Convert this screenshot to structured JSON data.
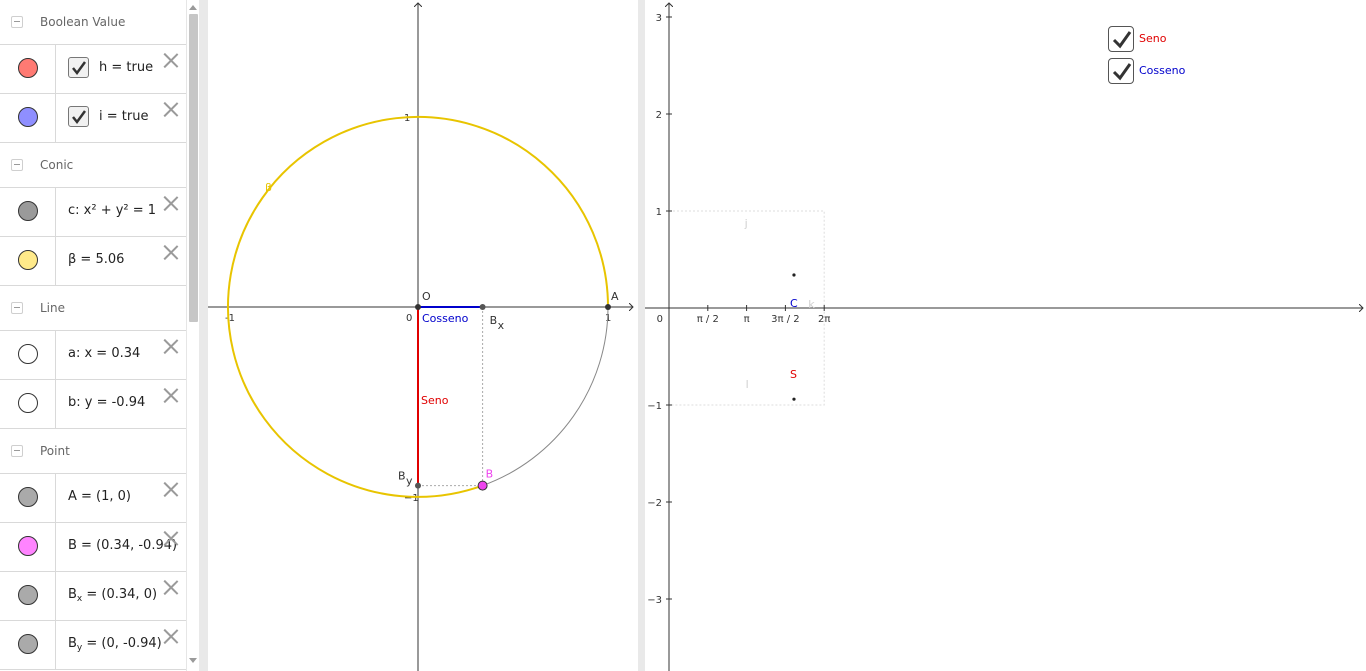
{
  "algebra": {
    "groups": [
      {
        "title": "Boolean Value",
        "items": [
          {
            "color": "#ff7a73",
            "checkbox": true,
            "text": "h = true"
          },
          {
            "color": "#8f8fff",
            "checkbox": true,
            "text": "i = true"
          }
        ]
      },
      {
        "title": "Conic",
        "items": [
          {
            "color": "#9a9a9a",
            "checkbox": false,
            "text": "c: x² + y² = 1"
          },
          {
            "color": "#ffea8a",
            "checkbox": false,
            "text": "β = 5.06"
          }
        ]
      },
      {
        "title": "Line",
        "items": [
          {
            "color": "#ffffff",
            "checkbox": false,
            "text": "a: x = 0.34"
          },
          {
            "color": "#ffffff",
            "checkbox": false,
            "text": "b: y = -0.94"
          }
        ]
      },
      {
        "title": "Point",
        "items": [
          {
            "color": "#aaaaaa",
            "checkbox": false,
            "text": "A = (1, 0)"
          },
          {
            "color": "#ff84ff",
            "checkbox": false,
            "text": "B = (0.34, -0.94)"
          },
          {
            "color": "#aaaaaa",
            "checkbox": false,
            "name_main": "B",
            "name_sub": "x",
            "rest": " = (0.34, 0)"
          },
          {
            "color": "#aaaaaa",
            "checkbox": false,
            "name_main": "B",
            "name_sub": "y",
            "rest": " = (0, -0.94)"
          }
        ]
      }
    ]
  },
  "view1": {
    "x_ticks": [
      {
        "value": -1,
        "label": "-1"
      },
      {
        "value": 0,
        "label": "0"
      },
      {
        "value": 1,
        "label": "1"
      }
    ],
    "y_ticks": [
      {
        "value": 1,
        "label": "1"
      },
      {
        "value": -1,
        "label": "−1"
      }
    ],
    "angle_label": "β",
    "points": {
      "O": {
        "label": "O",
        "x": 0,
        "y": 0
      },
      "A": {
        "label": "A",
        "x": 1,
        "y": 0
      },
      "B": {
        "label": "B",
        "x": 0.34,
        "y": -0.94
      },
      "Bx": {
        "label": "B",
        "sub": "x",
        "x": 0.34,
        "y": 0
      },
      "By": {
        "label": "B",
        "sub": "y",
        "x": 0,
        "y": -0.94
      }
    },
    "seno_label": "Seno",
    "cosseno_label": "Cosseno",
    "colors": {
      "circle": "#e8c400",
      "seno": "#e00000",
      "cosseno": "#0000cc",
      "point_b": "#ee44ee"
    }
  },
  "view2": {
    "x_ticks": [
      {
        "value": 0,
        "label": "0"
      },
      {
        "value": 1.5708,
        "label": "π / 2"
      },
      {
        "value": 3.1416,
        "label": "π"
      },
      {
        "value": 4.7124,
        "label": "3π / 2"
      },
      {
        "value": 6.2832,
        "label": "2π"
      }
    ],
    "y_ticks": [
      {
        "value": 3,
        "label": "3"
      },
      {
        "value": 2,
        "label": "2"
      },
      {
        "value": 1,
        "label": "1"
      },
      {
        "value": -1,
        "label": "−1"
      },
      {
        "value": -2,
        "label": "−2"
      },
      {
        "value": -3,
        "label": "−3"
      }
    ],
    "beta": 5.06,
    "sin_point": {
      "label": "S",
      "x": 5.06,
      "y": -0.94
    },
    "cos_point": {
      "label": "C",
      "x": 5.06,
      "y": 0.34
    },
    "faint_labels": [
      "j",
      "l",
      "k"
    ],
    "checkboxes": [
      {
        "label": "Seno",
        "checked": true,
        "color": "#e00000"
      },
      {
        "label": "Cosseno",
        "checked": true,
        "color": "#0000cc"
      }
    ]
  }
}
